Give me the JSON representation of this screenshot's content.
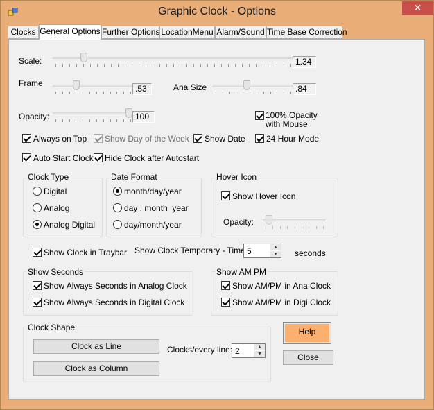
{
  "window": {
    "title": "Graphic Clock - Options",
    "close_glyph": "✕",
    "accent": "#e9ae78"
  },
  "tabs": [
    "Clocks",
    "General Options",
    "Further Options",
    "LocationMenu",
    "Alarm/Sound",
    "Time Base Correction"
  ],
  "sliders": {
    "scale": {
      "label": "Scale:",
      "value": "1.34",
      "level": 0.12
    },
    "frame": {
      "label": "Frame",
      "value": ".53",
      "level": 0.28
    },
    "ana_size": {
      "label": "Ana Size",
      "value": ".84",
      "level": 0.42
    },
    "opacity": {
      "label": "Opacity:",
      "value": "100",
      "level": 1.0
    }
  },
  "options": {
    "full_opacity_mouse": {
      "label_line1": "100% Opacity",
      "label_line2": "with Mouse",
      "checked": true
    },
    "always_on_top": {
      "label": "Always on Top",
      "checked": true
    },
    "show_day_of_week": {
      "label": "Show Day of the Week",
      "checked": true,
      "enabled": false
    },
    "show_date": {
      "label": "Show Date",
      "checked": true
    },
    "hour24": {
      "label": "24 Hour Mode",
      "checked": true
    },
    "auto_start": {
      "label": "Auto Start Clock",
      "checked": true
    },
    "hide_after_autostart": {
      "label": "Hide Clock after Autostart",
      "checked": true
    }
  },
  "clock_type": {
    "title": "Clock Type",
    "options": [
      "Digital",
      "Analog",
      "Analog Digital"
    ],
    "selected": 2
  },
  "date_format": {
    "title": "Date Format",
    "options": [
      "month/day/year",
      "day . month  year",
      "day/month/year"
    ],
    "selected": 0
  },
  "hover_icon": {
    "title": "Hover Icon",
    "show_label": "Show Hover Icon",
    "checked": true,
    "opacity_label": "Opacity:",
    "opacity_level": 0.05
  },
  "traybar": {
    "label": "Show Clock in Traybar",
    "checked": true
  },
  "temporary": {
    "label": "Show Clock Temporary - Time:",
    "value": "5",
    "unit": "seconds"
  },
  "show_seconds": {
    "title": "Show Seconds",
    "analog": "Show Always Seconds in Analog Clock",
    "digital": "Show Always Seconds in Digital Clock"
  },
  "show_ampm": {
    "title": "Show AM PM",
    "ana": "Show AM/PM in Ana Clock",
    "digi": "Show AM/PM in Digi Clock"
  },
  "clock_shape": {
    "title": "Clock Shape",
    "line_button": "Clock as Line",
    "column_button": "Clock as Column",
    "per_line_label": "Clocks/every line:",
    "per_line_value": "2"
  },
  "buttons": {
    "help": "Help",
    "close": "Close"
  }
}
